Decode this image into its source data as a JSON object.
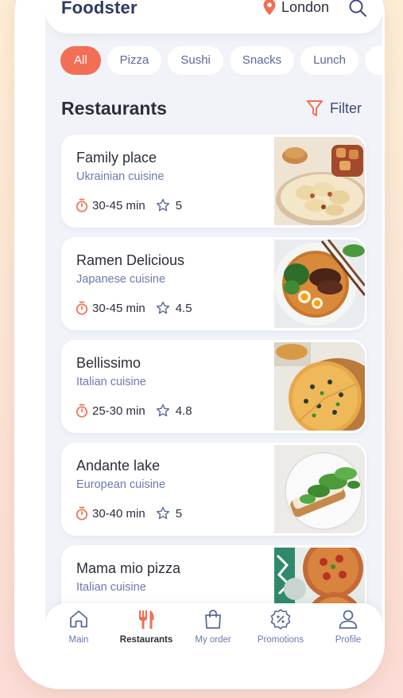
{
  "header": {
    "app_title": "Foodster",
    "location": "London",
    "location_icon": "map-pin-icon",
    "search_icon": "search-icon"
  },
  "categories": [
    "All",
    "Pizza",
    "Sushi",
    "Snacks",
    "Lunch",
    ""
  ],
  "active_category": "All",
  "section": {
    "title": "Restaurants",
    "filter_label": "Filter"
  },
  "restaurants": [
    {
      "name": "Family place",
      "cuisine": "Ukrainian cuisine",
      "time": "30-45 min",
      "rating": "5"
    },
    {
      "name": "Ramen Delicious",
      "cuisine": "Japanese cuisine",
      "time": "30-45 min",
      "rating": "4.5"
    },
    {
      "name": "Bellissimo",
      "cuisine": "Italian cuisine",
      "time": "25-30 min",
      "rating": "4.8"
    },
    {
      "name": "Andante lake",
      "cuisine": "European cuisine",
      "time": "30-40 min",
      "rating": "5"
    },
    {
      "name": "Mama mio pizza",
      "cuisine": "Italian cuisine",
      "time": "",
      "rating": ""
    }
  ],
  "nav": [
    {
      "label": "Main",
      "icon": "home-icon",
      "active": false
    },
    {
      "label": "Restaurants",
      "icon": "fork-knife-icon",
      "active": true
    },
    {
      "label": "My order",
      "icon": "shopping-bag-icon",
      "active": false
    },
    {
      "label": "Promotions",
      "icon": "discount-badge-icon",
      "active": false
    },
    {
      "label": "Profile",
      "icon": "user-icon",
      "active": false
    }
  ],
  "colors": {
    "accent": "#f26f55",
    "brand_text": "#2c3a64",
    "secondary_text": "#6a7ab0",
    "background": "#f1f3f9"
  }
}
